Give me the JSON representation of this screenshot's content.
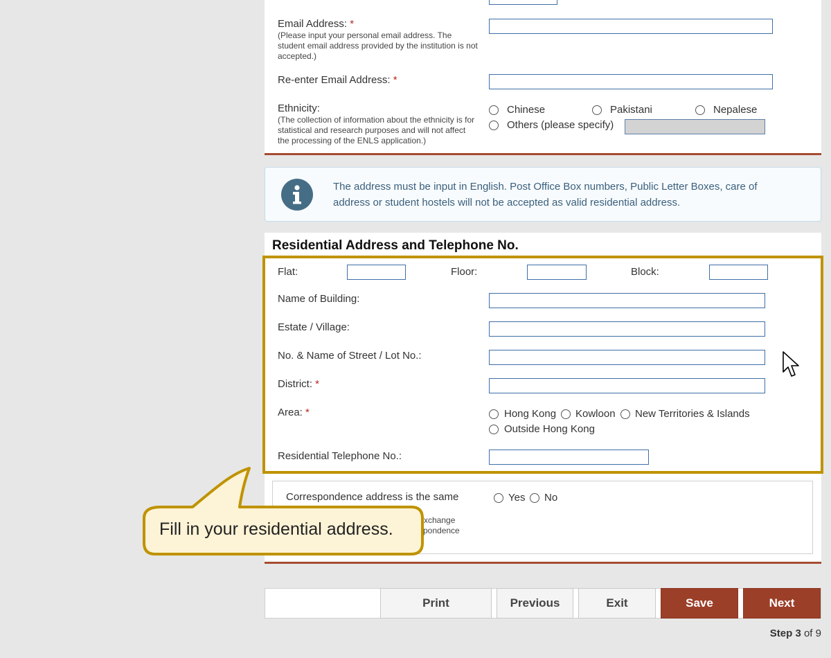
{
  "personal": {
    "email_label": "Email Address:",
    "email_note": "(Please input your personal email address. The student email address provided by the institution is not accepted.)",
    "reenter_label": "Re-enter Email Address:",
    "ethnicity_label": "Ethnicity:",
    "ethnicity_note": "(The collection of information about the ethnicity is for statistical and research purposes and will not affect the processing of the ENLS application.)",
    "ethnicity_options": [
      "Chinese",
      "Pakistani",
      "Nepalese",
      "Others (please specify)"
    ],
    "required_mark": "*"
  },
  "info_box": {
    "text": "The address must be input in English. Post Office Box numbers, Public Letter Boxes, care of address or student hostels will not be accepted as valid residential address."
  },
  "address": {
    "title": "Residential Address and Telephone No.",
    "flat_label": "Flat:",
    "floor_label": "Floor:",
    "block_label": "Block:",
    "building_label": "Name of Building:",
    "estate_label": "Estate / Village:",
    "street_label": "No. & Name of Street / Lot No.:",
    "district_label": "District:",
    "area_label": "Area:",
    "area_options": [
      "Hong Kong",
      "Kowloon",
      "New Territories & Islands",
      "Outside Hong Kong"
    ],
    "phone_label": "Residential Telephone No.:"
  },
  "correspondence": {
    "label": "Correspondence address is the same",
    "note_line1": "xchange",
    "note_line2": "spondence",
    "options": [
      "Yes",
      "No"
    ]
  },
  "callout": {
    "text": "Fill in your residential address."
  },
  "buttons": {
    "print": "Print",
    "previous": "Previous",
    "exit": "Exit",
    "save": "Save",
    "next": "Next"
  },
  "step": {
    "label": "Step",
    "current": "3",
    "of_text": "of 9"
  },
  "colors": {
    "accent": "#9c3f29",
    "highlight_border": "#bf9300",
    "input_border": "#3e6ea8",
    "info_icon": "#466d86"
  }
}
